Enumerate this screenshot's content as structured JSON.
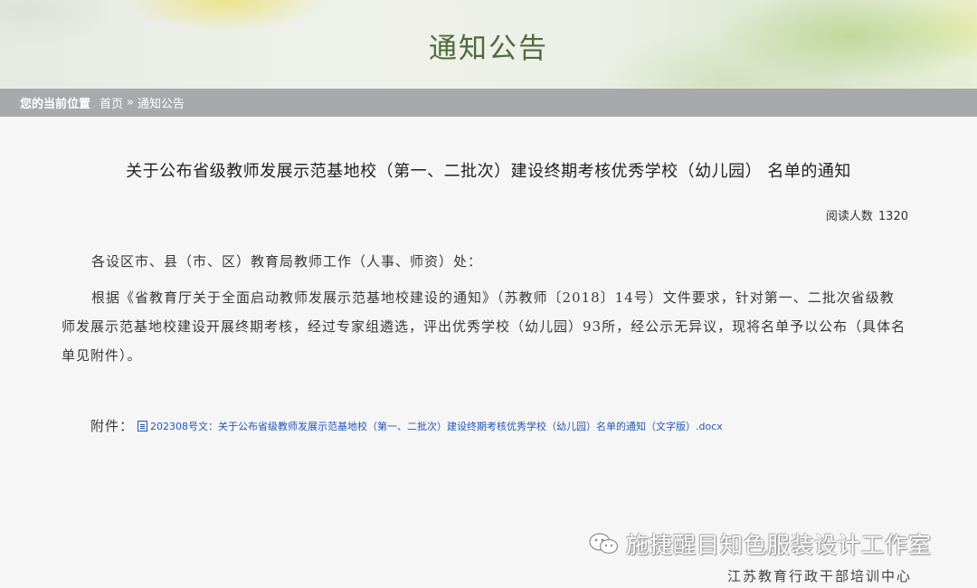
{
  "banner": {
    "title": "通知公告"
  },
  "breadcrumb": {
    "label": "您的当前位置",
    "home": "首页",
    "separator": "»",
    "current": "通知公告"
  },
  "article": {
    "title": "关于公布省级教师发展示范基地校（第一、二批次）建设终期考核优秀学校（幼儿园） 名单的通知",
    "read_label": "阅读人数",
    "read_count": "1320",
    "salutation": "各设区市、县（市、区）教育局教师工作（人事、师资）处：",
    "body": "根据《省教育厅关于全面启动教师发展示范基地校建设的通知》（苏教师〔2018〕14号）文件要求，针对第一、二批次省级教师发展示范基地校建设开展终期考核，经过专家组遴选，评出优秀学校（幼儿园）93所，经公示无异议，现将名单予以公布（具体名单见附件）。",
    "attachment_label": "附件：",
    "attachment_icon": "word-doc-icon",
    "attachment_name": "202308号文：关于公布省级教师发展示范基地校（第一、二批次）建设终期考核优秀学校（幼儿园）名单的通知（文字版）.docx"
  },
  "watermark": {
    "icon": "wechat-icon",
    "text": "施捷醒目知色服装设计工作室",
    "sub": "江苏教育行政干部培训中心"
  },
  "colors": {
    "banner_title": "#4f6b3a",
    "breadcrumb_bg": "#a8a9ab",
    "link": "#2556b8",
    "page_bg": "#f6f6f6"
  }
}
